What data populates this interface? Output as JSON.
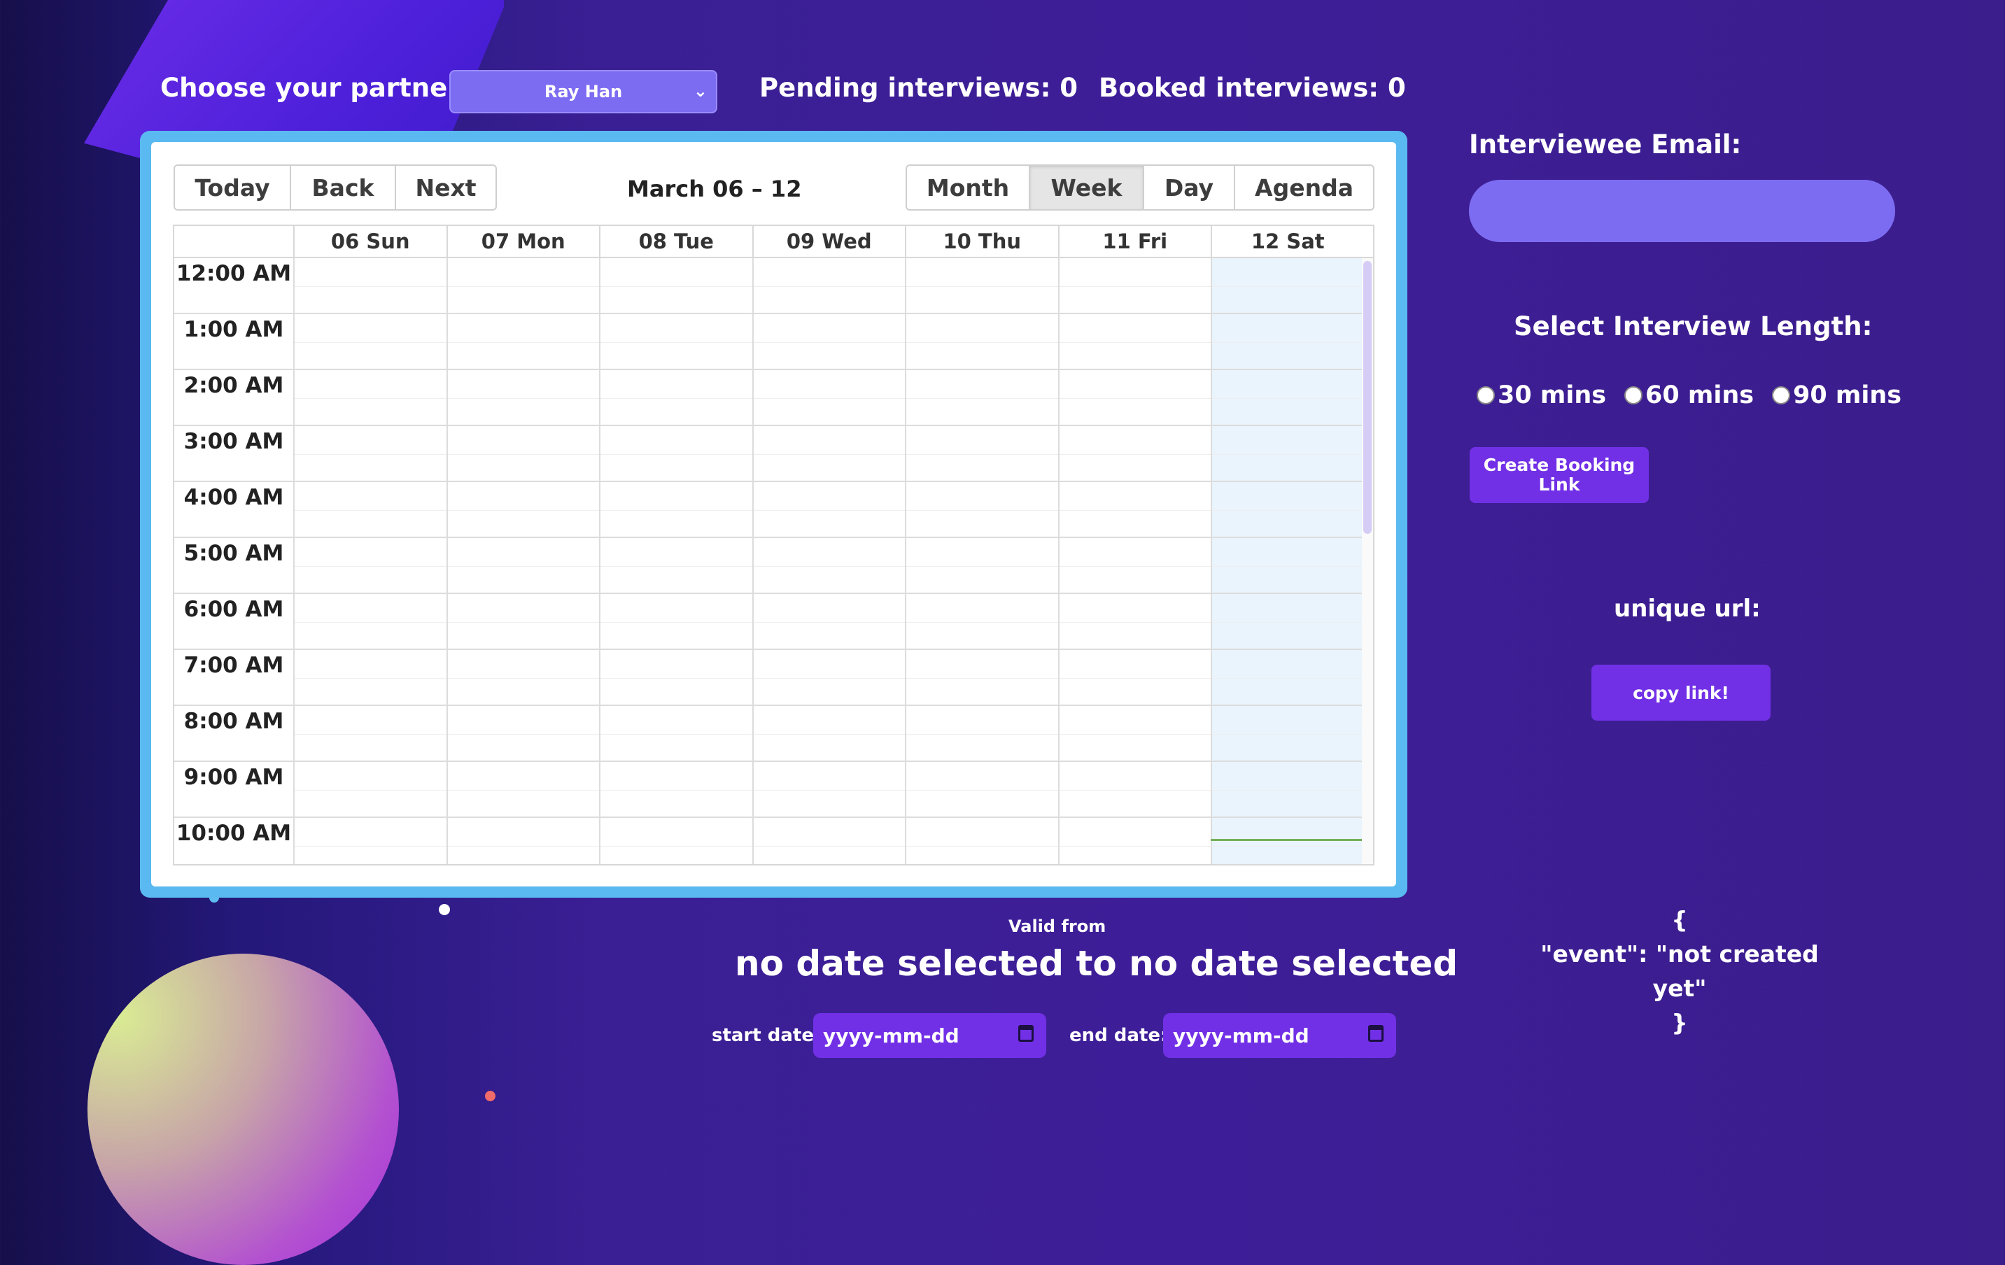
{
  "header": {
    "choose_label": "Choose your partner:",
    "partner_selected": "Ray Han",
    "pending": "Pending interviews: 0",
    "booked": "Booked interviews: 0"
  },
  "calendar": {
    "nav": {
      "today": "Today",
      "back": "Back",
      "next": "Next"
    },
    "title": "March 06 – 12",
    "views": {
      "month": "Month",
      "week": "Week",
      "day": "Day",
      "agenda": "Agenda",
      "active": "Week"
    },
    "days": [
      "06 Sun",
      "07 Mon",
      "08 Tue",
      "09 Wed",
      "10 Thu",
      "11 Fri",
      "12 Sat"
    ],
    "times": [
      "12:00 AM",
      "1:00 AM",
      "2:00 AM",
      "3:00 AM",
      "4:00 AM",
      "5:00 AM",
      "6:00 AM",
      "7:00 AM",
      "8:00 AM",
      "9:00 AM",
      "10:00 AM"
    ]
  },
  "sidebar": {
    "email_label": "Interviewee Email:",
    "email_value": "",
    "length_label": "Select Interview Length:",
    "lengths": [
      "30 mins",
      "60 mins",
      "90 mins"
    ],
    "create_button": "Create Booking Link",
    "unique_label": "unique url:",
    "copy_button": "copy link!",
    "json_open": "{",
    "json_line": "\"event\": \"not created yet\"",
    "json_close": "}"
  },
  "validity": {
    "valid_from": "Valid from",
    "summary": "no date selected to no date selected",
    "start_label": "start date:",
    "end_label": "end date:",
    "start_placeholder": "yyyy-mm-dd",
    "end_placeholder": "yyyy-mm-dd"
  },
  "colors": {
    "accent": "#7230e6",
    "input_bg": "#7c6cf2",
    "calendar_frame": "#5bb9f1",
    "today_highlight": "#e9f4fd"
  }
}
